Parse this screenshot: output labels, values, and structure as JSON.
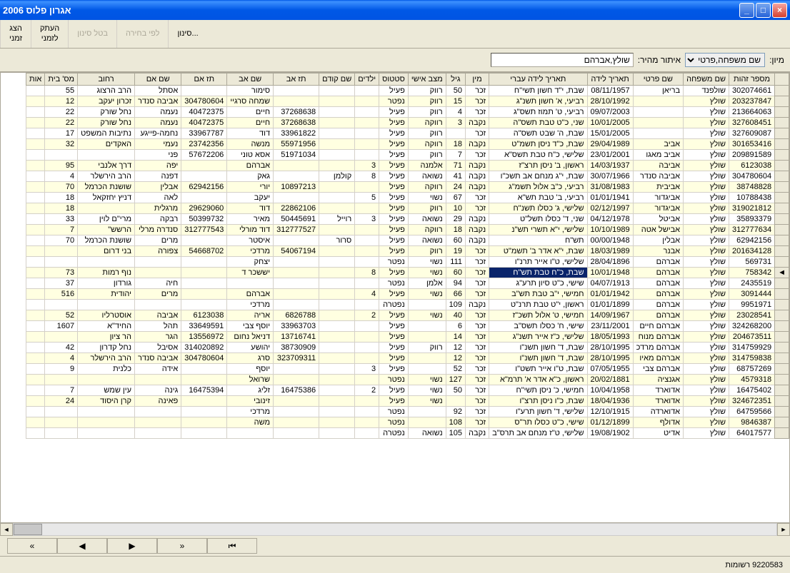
{
  "title": "אגרון פלוס 2006",
  "toolbar": {
    "show_temp": "הצג\nזמני",
    "copy_temp": "העתק\nלזמני",
    "cancel_filter": "בטל סינון",
    "by_selection": "לפי בחירה",
    "filter": "סינון..."
  },
  "filter": {
    "sort_label": "מיון:",
    "sort_value": "שם משפחה,פרטי",
    "locate_label": "איתור מהיר:",
    "locate_value": "שולץ,אברהם"
  },
  "columns": [
    "מספר זהות",
    "שם משפחה",
    "שם פרטי",
    "תאריך לידה",
    "תאריך לידה עברי",
    "מין",
    "גיל",
    "מצב אישי",
    "סטטוס",
    "ילדים",
    "שם קודם",
    "תז אב",
    "שם אב",
    "תז אם",
    "שם אם",
    "רחוב",
    "מס' בית",
    "אות"
  ],
  "rows": [
    {
      "cells": [
        "302074661",
        "שולפנד",
        "בריאן",
        "08/11/1957",
        "שבת, י\"ד חשון תשי\"ח",
        "זכר",
        "50",
        "רווק",
        "פעיל",
        "",
        "",
        "",
        "סימור",
        "",
        "אסתל",
        "הרב הרצוג",
        "55",
        ""
      ]
    },
    {
      "cells": [
        "203237847",
        "שולץ",
        "",
        "28/10/1992",
        "רביעי, א' חשון תשנ\"ג",
        "זכר",
        "15",
        "רווק",
        "נפטר",
        "",
        "",
        "",
        "שמחה סרגיי",
        "304780604",
        "אביבה סנדר",
        "זכרון יעקב",
        "12",
        ""
      ]
    },
    {
      "cells": [
        "213664063",
        "שולץ",
        "",
        "09/07/2003",
        "רביעי, ט' תמוז תשס\"ג",
        "זכר",
        "4",
        "רווק",
        "פעיל",
        "",
        "",
        "37268638",
        "חיים",
        "40472375",
        "נעמה",
        "נחל שורק",
        "22",
        ""
      ]
    },
    {
      "cells": [
        "327608451",
        "שולץ",
        "",
        "10/01/2005",
        "שני, כ\"ט טבת תשס\"ה",
        "נקבה",
        "3",
        "רווקה",
        "פעיל",
        "",
        "",
        "37268638",
        "חיים",
        "40472375",
        "נעמה",
        "נחל שורק",
        "22",
        ""
      ]
    },
    {
      "cells": [
        "327609087",
        "שולץ",
        "",
        "15/01/2005",
        "שבת, ה' שבט תשס\"ה",
        "זכר",
        "",
        "רווק",
        "פעיל",
        "",
        "",
        "33961822",
        "דוד",
        "33967787",
        "נחמה-פייגע",
        "נתיבות המשפט",
        "17",
        ""
      ]
    },
    {
      "cells": [
        "301653416",
        "שולץ",
        "אביב",
        "29/04/1989",
        "שבת, כ\"ד ניסן תשמ\"ט",
        "נקבה",
        "18",
        "רווקה",
        "פעיל",
        "",
        "",
        "55971956",
        "מנשה",
        "23742356",
        "נעמי",
        "האקדים",
        "32",
        ""
      ]
    },
    {
      "cells": [
        "209891589",
        "שולץ",
        "אביב מאגו",
        "23/01/2001",
        "שלישי, כ\"ח טבת תשס\"א",
        "זכר",
        "7",
        "רווק",
        "פעיל",
        "",
        "",
        "51971034",
        "אסא טוני",
        "57672206",
        "פני",
        "",
        "",
        ""
      ]
    },
    {
      "cells": [
        "6123038",
        "שולץ",
        "אביבה",
        "14/03/1937",
        "ראשון, ב' ניסן תרצ\"ז",
        "נקבה",
        "71",
        "אלמנה",
        "פעיל",
        "3",
        "",
        "",
        "אברהם",
        "",
        "יפה",
        "דרך אלנבי",
        "95",
        ""
      ]
    },
    {
      "cells": [
        "304780604",
        "שולץ",
        "אביבה סנדר",
        "30/07/1966",
        "שבת, י\"ג מנחם אב תשכ\"ו",
        "נקבה",
        "41",
        "נשואה",
        "פעיל",
        "8",
        "קולמן",
        "",
        "גאק",
        "",
        "דפנה",
        "הרב הירשלר",
        "4",
        ""
      ]
    },
    {
      "cells": [
        "38748828",
        "שולץ",
        "אביבית",
        "31/08/1983",
        "רביעי, כ\"ב אלול תשמ\"ג",
        "נקבה",
        "24",
        "רווקה",
        "פעיל",
        "",
        "",
        "10897213",
        "יורי",
        "62942156",
        "אבלין",
        "שושנת הכרמל",
        "70",
        ""
      ]
    },
    {
      "cells": [
        "10788438",
        "שולץ",
        "אביגדור",
        "01/01/1941",
        "רביעי, ב' טבת תש\"א",
        "זכר",
        "67",
        "נשוי",
        "פעיל",
        "5",
        "",
        "",
        "יעקב",
        "",
        "לאה",
        "דניץ יחזקאל",
        "18",
        ""
      ]
    },
    {
      "cells": [
        "319021812",
        "שולץ",
        "אביגדור",
        "02/12/1997",
        "שלישי, ג' כסלו תשנ\"ח",
        "זכר",
        "10",
        "רווק",
        "פעיל",
        "",
        "",
        "22862106",
        "דוד",
        "29629060",
        "מרגלית",
        "",
        "18",
        ""
      ]
    },
    {
      "cells": [
        "35893379",
        "שולץ",
        "אביטל",
        "04/12/1978",
        "שני, ד' כסלו תשל\"ט",
        "נקבה",
        "29",
        "נשואה",
        "פעיל",
        "3",
        "רוייל",
        "50445691",
        "מאיר",
        "50399732",
        "רבקה",
        "מרי\"ם לוין",
        "33",
        ""
      ]
    },
    {
      "cells": [
        "312777634",
        "שולץ",
        "אבישל אטה",
        "10/10/1989",
        "שלישי, י\"א תשרי תש\"נ",
        "נקבה",
        "18",
        "רווקה",
        "פעיל",
        "",
        "",
        "312777527",
        "דוד מורלי",
        "312777543",
        "סנדרה מרלי",
        "הרשש\"",
        "7",
        ""
      ]
    },
    {
      "cells": [
        "62942156",
        "שולץ",
        "אבלין",
        "00/00/1948",
        "תש\"ח",
        "נקבה",
        "60",
        "נשואה",
        "פעיל",
        "",
        "סרור",
        "",
        "איסטר",
        "",
        "מרים",
        "שושנת הכרמל",
        "70",
        ""
      ]
    },
    {
      "cells": [
        "201634128",
        "שולץ",
        "אבנר",
        "18/03/1989",
        "שבת, י\"א אדר ב' תשמ\"ט",
        "זכר",
        "19",
        "רווק",
        "פעיל",
        "",
        "",
        "54067194",
        "מרדכי",
        "54668702",
        "צפורה",
        "בני דרום",
        "",
        ""
      ]
    },
    {
      "cells": [
        "569731",
        "שולץ",
        "אברהם",
        "28/04/1896",
        "שלישי, ט\"ו אייר תרנ\"ו",
        "זכר",
        "111",
        "נשוי",
        "נפטר",
        "",
        "",
        "",
        "יצחק",
        "",
        "",
        "",
        "",
        ""
      ]
    },
    {
      "cells": [
        "758342",
        "שולץ",
        "אברהם",
        "10/01/1948",
        "שבת, כ\"ח טבת תש\"ח",
        "זכר",
        "60",
        "נשוי",
        "פעיל",
        "8",
        "",
        "",
        "יששכר ד",
        "",
        "",
        "נוף רמות",
        "73",
        ""
      ],
      "hl": 4,
      "ind": true
    },
    {
      "cells": [
        "2435519",
        "שולץ",
        "אברהם",
        "04/07/1913",
        "שישי, כ\"ט סיון תרע\"ג",
        "זכר",
        "94",
        "אלמן",
        "נפטר",
        "",
        "",
        "",
        "",
        "",
        "חיה",
        "גורדון",
        "37",
        ""
      ]
    },
    {
      "cells": [
        "3091444",
        "שולץ",
        "אברהם",
        "01/01/1942",
        "חמישי, י\"ב טבת תש\"ב",
        "זכר",
        "66",
        "נשוי",
        "פעיל",
        "4",
        "",
        "",
        "אברהם",
        "",
        "מרים",
        "יהודית",
        "516",
        ""
      ]
    },
    {
      "cells": [
        "9951971",
        "שולץ",
        "אברהם",
        "01/01/1899",
        "ראשון, י\"ט טבת תרנ\"ט",
        "נקבה",
        "109",
        "",
        "נפטרה",
        "",
        "",
        "",
        "מרדכי",
        "",
        "",
        "",
        "",
        ""
      ]
    },
    {
      "cells": [
        "23028541",
        "שולץ",
        "אברהם",
        "14/09/1967",
        "חמישי, ט' אלול תשכ\"ז",
        "זכר",
        "40",
        "נשוי",
        "פעיל",
        "2",
        "",
        "6826788",
        "אריה",
        "6123038",
        "אביבה",
        "אוסטרליו",
        "52",
        ""
      ]
    },
    {
      "cells": [
        "324268200",
        "שולץ",
        "אברהם חיים",
        "23/11/2001",
        "שישי, ח' כסלו תשס\"ב",
        "זכר",
        "6",
        "",
        "פעיל",
        "",
        "",
        "33963703",
        "יוסף צבי",
        "33649591",
        "תהל",
        "החיד\"א",
        "1607",
        ""
      ]
    },
    {
      "cells": [
        "204673511",
        "שולץ",
        "אברהם מנוח",
        "18/05/1993",
        "שלישי, כ\"ז אייר תשנ\"ג",
        "זכר",
        "14",
        "",
        "פעיל",
        "",
        "",
        "13716741",
        "דניאל נחום",
        "13556972",
        "הגר",
        "הר ציון",
        "",
        ""
      ]
    },
    {
      "cells": [
        "314759929",
        "שולץ",
        "אברהם מרדכ",
        "28/10/1995",
        "שבת, ד' חשון תשנ\"ו",
        "זכר",
        "12",
        "רווק",
        "פעיל",
        "",
        "",
        "38730909",
        "יהושע",
        "314020892",
        "אסיבל",
        "נחל קדרון",
        "42",
        ""
      ]
    },
    {
      "cells": [
        "314759838",
        "שולץ",
        "אברהם מאיו",
        "28/10/1995",
        "שבת, ד' חשון תשנ\"ו",
        "זכר",
        "12",
        "",
        "פעיל",
        "",
        "",
        "323709311",
        "סרג",
        "304780604",
        "אביבה סנדר",
        "הרב הירשלר",
        "4",
        ""
      ]
    },
    {
      "cells": [
        "68757269",
        "שולץ",
        "אברהם צבי",
        "07/05/1955",
        "שבת, ט\"ו אייר תשט\"ו",
        "זכר",
        "52",
        "",
        "פעיל",
        "3",
        "",
        "",
        "יוסף",
        "",
        "אידה",
        "כלנית",
        "9",
        ""
      ]
    },
    {
      "cells": [
        "4579318",
        "שולץ",
        "אגנציה",
        "20/02/1881",
        "ראשון, כ\"א אדר א' תרמ\"א",
        "זכר",
        "127",
        "נשוי",
        "נפטר",
        "",
        "",
        "",
        "שרואל",
        "",
        "",
        "",
        "",
        ""
      ]
    },
    {
      "cells": [
        "16475402",
        "שולץ",
        "אדוארד",
        "10/04/1958",
        "חמישי, כ' ניסן תשי\"ח",
        "זכר",
        "50",
        "נשוי",
        "פעיל",
        "2",
        "",
        "16475386",
        "זליג",
        "16475394",
        "גינה",
        "עין שמש",
        "7",
        ""
      ]
    },
    {
      "cells": [
        "324672351",
        "שולץ",
        "אדוארד",
        "18/04/1936",
        "שבת, כ\"ו ניסן תרצ\"ו",
        "זכר",
        "",
        "נשוי",
        "פעיל",
        "",
        "",
        "",
        "זינובי",
        "",
        "פאינה",
        "קרן היסוד",
        "24",
        ""
      ]
    },
    {
      "cells": [
        "64759566",
        "שולץ",
        "אדוארדה",
        "12/10/1915",
        "שלישי, ד' חשון תרע\"ו",
        "זכר",
        "92",
        "",
        "נפטר",
        "",
        "",
        "",
        "מרדכי",
        "",
        "",
        "",
        "",
        ""
      ]
    },
    {
      "cells": [
        "9846387",
        "שולץ",
        "אדולף",
        "01/12/1899",
        "שישי, כ\"ט כסלו תר\"ס",
        "זכר",
        "108",
        "",
        "נפטר",
        "",
        "",
        "",
        "משה",
        "",
        "",
        "",
        "",
        ""
      ]
    },
    {
      "cells": [
        "64017577",
        "שולץ",
        "אדיט",
        "19/08/1902",
        "שלישי, ט\"ז מנחם אב תרס\"ב",
        "נקבה",
        "105",
        "נשואה",
        "נפטרה",
        "",
        "",
        "",
        "",
        "",
        "",
        "",
        "",
        ""
      ]
    }
  ],
  "nav": {
    "first": "⏮",
    "prev": "◀",
    "next": "▶",
    "last": "»",
    "ffwd": "«"
  },
  "status": "9220583 רשומות"
}
